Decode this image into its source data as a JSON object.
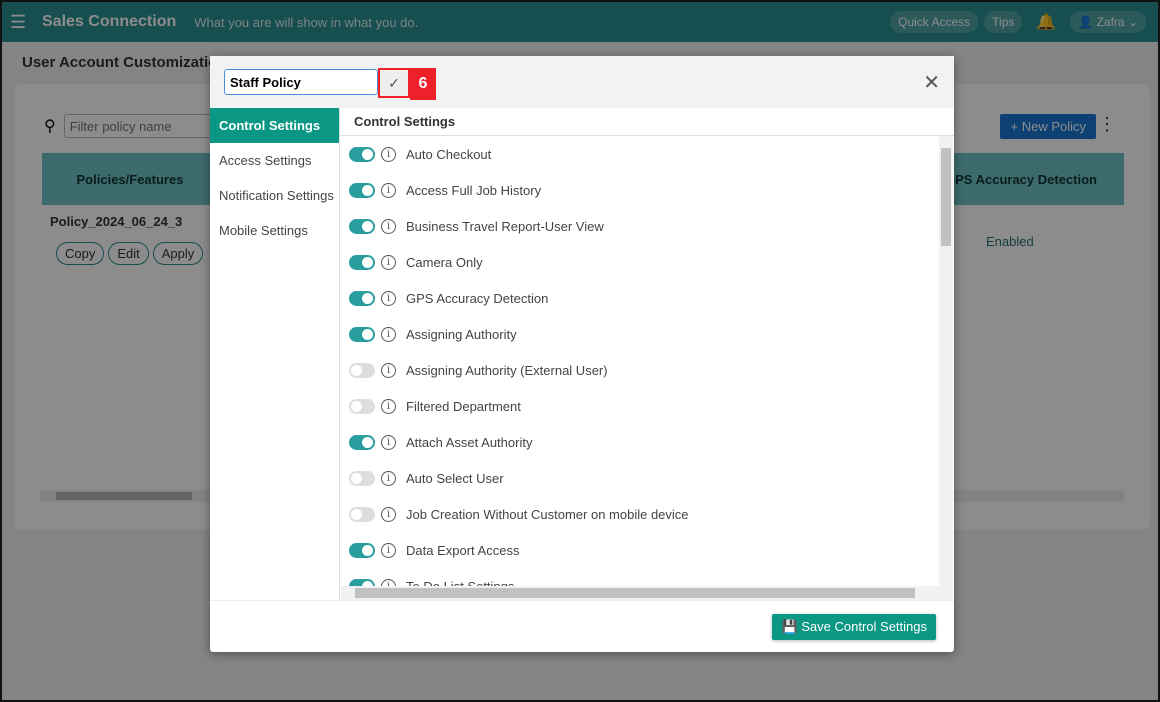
{
  "header": {
    "title": "Sales Connection",
    "tagline": "What you are will show in what you do.",
    "quick_access": "Quick Access",
    "tips": "Tips",
    "user": "Zafra"
  },
  "page": {
    "title": "User Account Customization",
    "filter_placeholder": "Filter policy name",
    "new_policy": "New Policy",
    "col_policies": "Policies/Features",
    "col_gps": "GPS Accuracy Detection",
    "policy_name": "Policy_2024_06_24_3",
    "copy": "Copy",
    "edit": "Edit",
    "apply": "Apply",
    "gps_value": "Enabled"
  },
  "modal": {
    "policy_name_value": "Staff Policy",
    "step_badge": "6",
    "section_title": "Control Settings",
    "save_label": "Save Control Settings",
    "tabs": [
      {
        "label": "Control Settings",
        "active": true
      },
      {
        "label": "Access Settings"
      },
      {
        "label": "Notification Settings"
      },
      {
        "label": "Mobile Settings"
      }
    ],
    "settings": [
      {
        "label": "Auto Checkout",
        "on": true
      },
      {
        "label": "Access Full Job History",
        "on": true
      },
      {
        "label": "Business Travel Report-User View",
        "on": true
      },
      {
        "label": "Camera Only",
        "on": true
      },
      {
        "label": "GPS Accuracy Detection",
        "on": true
      },
      {
        "label": "Assigning Authority",
        "on": true
      },
      {
        "label": "Assigning Authority (External User)",
        "on": false
      },
      {
        "label": "Filtered Department",
        "on": false
      },
      {
        "label": "Attach Asset Authority",
        "on": true
      },
      {
        "label": "Auto Select User",
        "on": false
      },
      {
        "label": "Job Creation Without Customer on mobile device",
        "on": false
      },
      {
        "label": "Data Export Access",
        "on": true
      },
      {
        "label": "To Do List Settings",
        "on": true
      }
    ]
  },
  "colors": {
    "header": "#2a8e92",
    "accent": "#0a9784",
    "primary": "#1976d2",
    "highlight": "#f0202a"
  }
}
